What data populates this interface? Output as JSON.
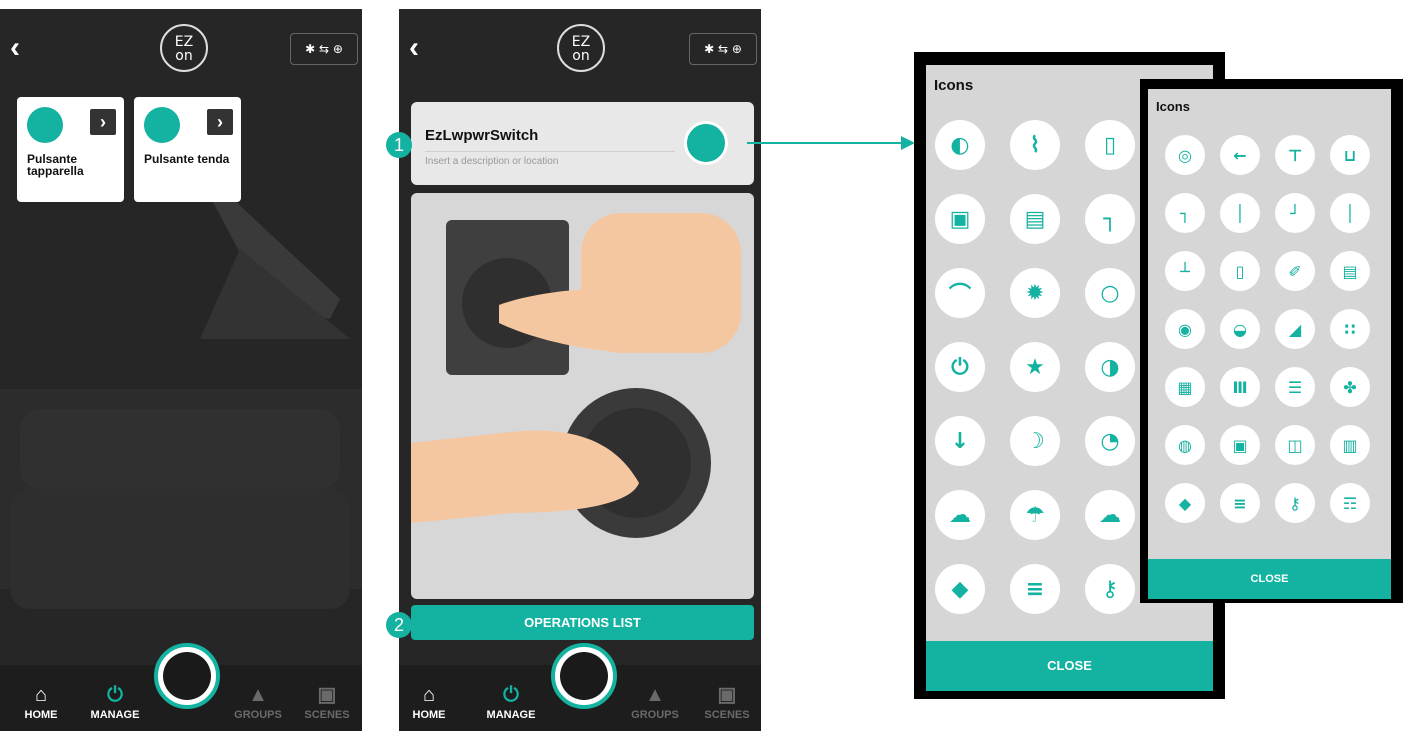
{
  "phone1": {
    "tiles": [
      {
        "label": "Pulsante tapparella"
      },
      {
        "label": "Pulsante tenda"
      }
    ]
  },
  "phone2": {
    "device_name": "EzLwpwrSwitch",
    "description_placeholder": "Insert a description or location",
    "operations_button": "OPERATIONS LIST",
    "badges": [
      "1",
      "2"
    ]
  },
  "header": {
    "logo_top": "EZ",
    "logo_bottom": "on",
    "status_glyphs": "✱ ⇆ ⊕"
  },
  "nav": {
    "home": "HOME",
    "manage": "MANAGE",
    "groups": "GROUPS",
    "scenes": "SCENES"
  },
  "icons_modal_1": {
    "title": "Icons",
    "close": "CLOSE",
    "icons": [
      "ezon-logo-icon",
      "thermometer-icon",
      "switch-panel-icon",
      "power-outlet-icon",
      "socket-icon",
      "floor-lamp-icon",
      "desk-lamp-icon",
      "sun-icon",
      "bulb-icon",
      "power-icon",
      "motion-sensor-icon",
      "contrast-icon",
      "plug-icon",
      "moon-icon",
      "gauge-icon",
      "cloud-icon",
      "rain-icon",
      "cloud-sun-icon",
      "remote-icon",
      "radiator-icon",
      "key-icon"
    ]
  },
  "icons_modal_2": {
    "title": "Icons",
    "close": "CLOSE",
    "icons": [
      "target-icon",
      "cable-icon",
      "pendant-lamp-icon",
      "ceiling-lamp-icon",
      "floor-lamp-icon",
      "wall-lamp-icon",
      "hook-lamp-icon",
      "standing-lamp-icon",
      "bedside-lamp-icon",
      "fridge-icon",
      "hair-dryer-icon",
      "microwave-icon",
      "washing-machine-icon",
      "dryer-icon",
      "iron-icon",
      "cooktop-icon",
      "dishwasher-icon",
      "heater-icon",
      "shutter-icon",
      "fan-icon",
      "laundry-icon",
      "oven-icon",
      "window-icon",
      "curtain-icon",
      "remote-icon",
      "radiator-icon",
      "key-icon",
      "air-conditioner-icon"
    ]
  },
  "colors": {
    "accent": "#13b2a1",
    "background": "#262626"
  }
}
